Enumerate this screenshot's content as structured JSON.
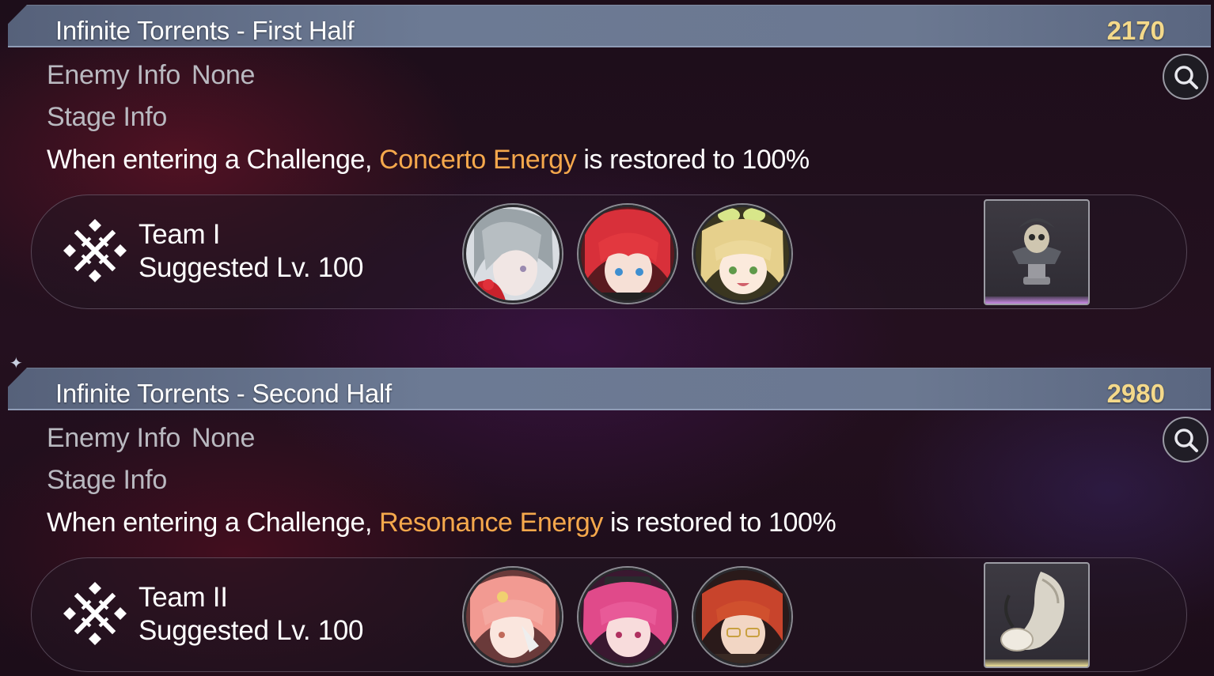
{
  "sections": [
    {
      "title": "Infinite Torrents - First Half",
      "score": "2170",
      "enemy_label": "Enemy Info",
      "enemy_value": "None",
      "stage_label": "Stage Info",
      "desc_prefix": "When entering a Challenge, ",
      "desc_highlight": "Concerto Energy",
      "desc_suffix": " is restored to 100%",
      "team_name": "Team I",
      "team_level": "Suggested Lv. 100",
      "reward_rarity_color": "#c98ce6"
    },
    {
      "title": "Infinite Torrents - Second Half",
      "score": "2980",
      "enemy_label": "Enemy Info",
      "enemy_value": "None",
      "stage_label": "Stage Info",
      "desc_prefix": "When entering a Challenge, ",
      "desc_highlight": "Resonance Energy",
      "desc_suffix": " is restored to 100%",
      "team_name": "Team II",
      "team_level": "Suggested Lv. 100",
      "reward_rarity_color": "#f0e29a"
    }
  ],
  "icons": {
    "search": "magnifier-icon",
    "team": "crossed-swords-emblem-icon",
    "reward_1": "pirate-skull-bust-icon",
    "reward_2": "horn-icon"
  },
  "colors": {
    "highlight": "#f5a84c",
    "score": "#f4d98a",
    "title_bar": "#6c7a94"
  }
}
